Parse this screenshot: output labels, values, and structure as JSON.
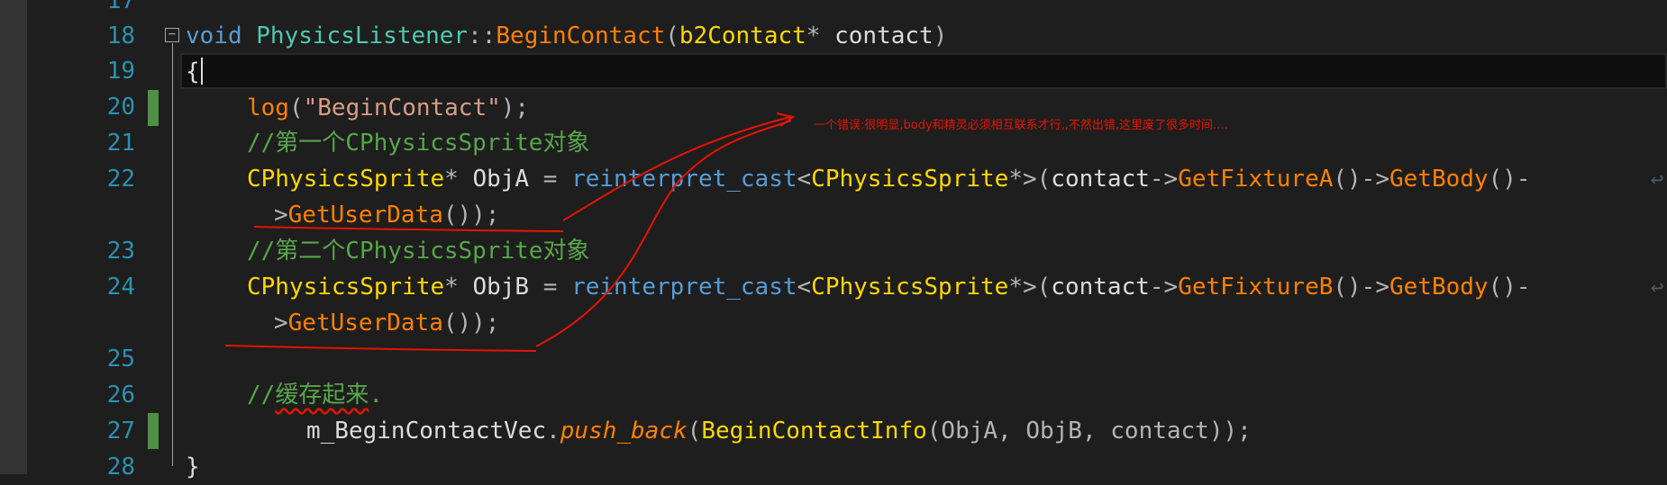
{
  "line_numbers": [
    "17",
    "18",
    "19",
    "20",
    "21",
    "22",
    "",
    "23",
    "24",
    "",
    "25",
    "26",
    "27",
    "28"
  ],
  "code": {
    "l18": {
      "kw": "void",
      "cls": "PhysicsListener",
      "sep": "::",
      "fn": "BeginContact",
      "p1": "(",
      "ty": "b2Contact",
      "ptr": "*",
      "param": " contact",
      "p2": ")"
    },
    "l19": {
      "brace": "{"
    },
    "l20": {
      "fn": "log",
      "p1": "(",
      "str": "\"BeginContact\"",
      "p2": ");"
    },
    "l21": {
      "cmt": "//第一个CPhysicsSprite对象"
    },
    "l22": {
      "ty": "CPhysicsSprite",
      "ptr": "* ",
      "var": "ObjA",
      "eq": " = ",
      "cast": "reinterpret_cast",
      "lt": "<",
      "ty2": "CPhysicsSprite",
      "gt": "*>(",
      "obj": "contact",
      "arrow": "->",
      "fn1": "GetFixtureA",
      "call1": "()->",
      "fn2": "GetBody",
      "call2": "()-"
    },
    "l22w": {
      "arrow": ">",
      "fn": "GetUserData",
      "end": "());"
    },
    "l23": {
      "cmt": "//第二个CPhysicsSprite对象"
    },
    "l24": {
      "ty": "CPhysicsSprite",
      "ptr": "* ",
      "var": "ObjB",
      "eq": " = ",
      "cast": "reinterpret_cast",
      "lt": "<",
      "ty2": "CPhysicsSprite",
      "gt": "*>(",
      "obj": "contact",
      "arrow": "->",
      "fn1": "GetFixtureB",
      "call1": "()->",
      "fn2": "GetBody",
      "call2": "()-"
    },
    "l24w": {
      "arrow": ">",
      "fn": "GetUserData",
      "end": "());"
    },
    "l26": {
      "cmt1": "//",
      "cmt2": "缓存起来",
      "cmt3": "."
    },
    "l27": {
      "var": "m_BeginContactVec",
      "dot": ".",
      "mfn": "push_back",
      "p1": "(",
      "fn": "BeginContactInfo",
      "args": "(ObjA, ObjB, contact));"
    },
    "l28": {
      "brace": "}"
    }
  },
  "wrap_glyph": "↩",
  "fold_glyph": "−",
  "annotation": "一个错误:很明显,body和精灵必须相互联系才行,,不然出错,这里废了很多时间....",
  "colors": {
    "background": "#1e1e1e",
    "line_number": "#2b91af",
    "change_bar": "#57a64a",
    "ink": "#e51400"
  }
}
